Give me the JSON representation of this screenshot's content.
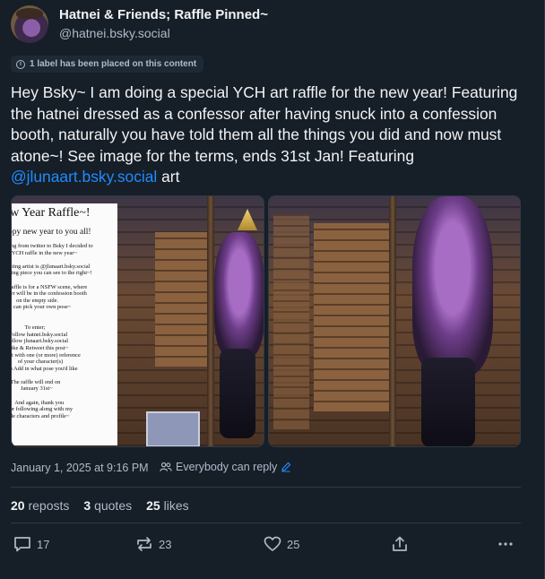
{
  "author": {
    "display_name": "Hatnei & Friends; Raffle Pinned~",
    "handle": "@hatnei.bsky.social"
  },
  "label_notice": "1 label has been placed on this content",
  "post": {
    "text_before_mention": "Hey Bsky~ I am doing a special YCH art raffle for the new year! Featuring the hatnei dressed as a confessor after having snuck into a confession booth, naturally you have told them all the things you did and now must atone~! See image for the terms, ends 31st Jan! Featuring ",
    "mention": "@jlunaart.bsky.social",
    "text_after_mention": " art"
  },
  "raffle_image": {
    "title": "ew Year Raffle~!",
    "subtitle": "ppy new year to you all!",
    "body": "ving from twitter to Bsky I decided to\n a YCH raffle in the new year~\n\nbuting artist is @jlunaart.bsky.social\nazing piece you can see to the right~!\n\nl raffle is for a NSFW scene, where\ncter will be in the confession booth\n       on the empty side.\nou can pick your own pose~\n\n\n             To enter;\n  Follow hatnei.bsky.social\nFollow jlunaart.bsky.social\n Like & Retweet this post~\nent with one (or more) reference\n        of your character(s)\nal) Add in what pose you'd like\n\n   The raffle will end on\n          January 31st~\n\n      And again, thank you\n for following along with my\nittle characters and profile~"
  },
  "meta": {
    "timestamp": "January 1, 2025 at 9:16 PM",
    "reply_setting": "Everybody can reply"
  },
  "stats": {
    "reposts_count": "20",
    "reposts_label": "reposts",
    "quotes_count": "3",
    "quotes_label": "quotes",
    "likes_count": "25",
    "likes_label": "likes"
  },
  "actions": {
    "reply_count": "17",
    "repost_count": "23",
    "like_count": "25"
  },
  "colors": {
    "background": "#161e27",
    "accent": "#208bfe",
    "muted_text": "#aebbc9",
    "border": "#2e3a48"
  },
  "icons": [
    "info-icon",
    "people-icon",
    "edit-icon",
    "reply-icon",
    "repost-icon",
    "heart-icon",
    "share-icon",
    "more-icon"
  ]
}
